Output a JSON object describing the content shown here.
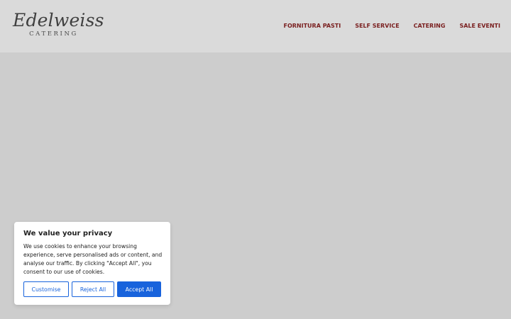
{
  "brand": {
    "name": "Edelweiss",
    "subtitle": "CATERING"
  },
  "nav": {
    "items": [
      {
        "label": "FORNITURA PASTI"
      },
      {
        "label": "SELF SERVICE"
      },
      {
        "label": "CATERING"
      },
      {
        "label": "SALE EVENTI"
      }
    ]
  },
  "cookie_banner": {
    "title": "We value your privacy",
    "text": "We use cookies to enhance your browsing experience, serve personalised ads or content, and analyse our traffic. By clicking \"Accept All\", you consent to our use of cookies.",
    "customise_label": "Customise",
    "reject_label": "Reject All",
    "accept_label": "Accept All"
  },
  "colors": {
    "header_bg": "#dadada",
    "page_bg": "#cdcdcd",
    "nav_text": "#7a1f1f",
    "accent": "#1863dc"
  }
}
